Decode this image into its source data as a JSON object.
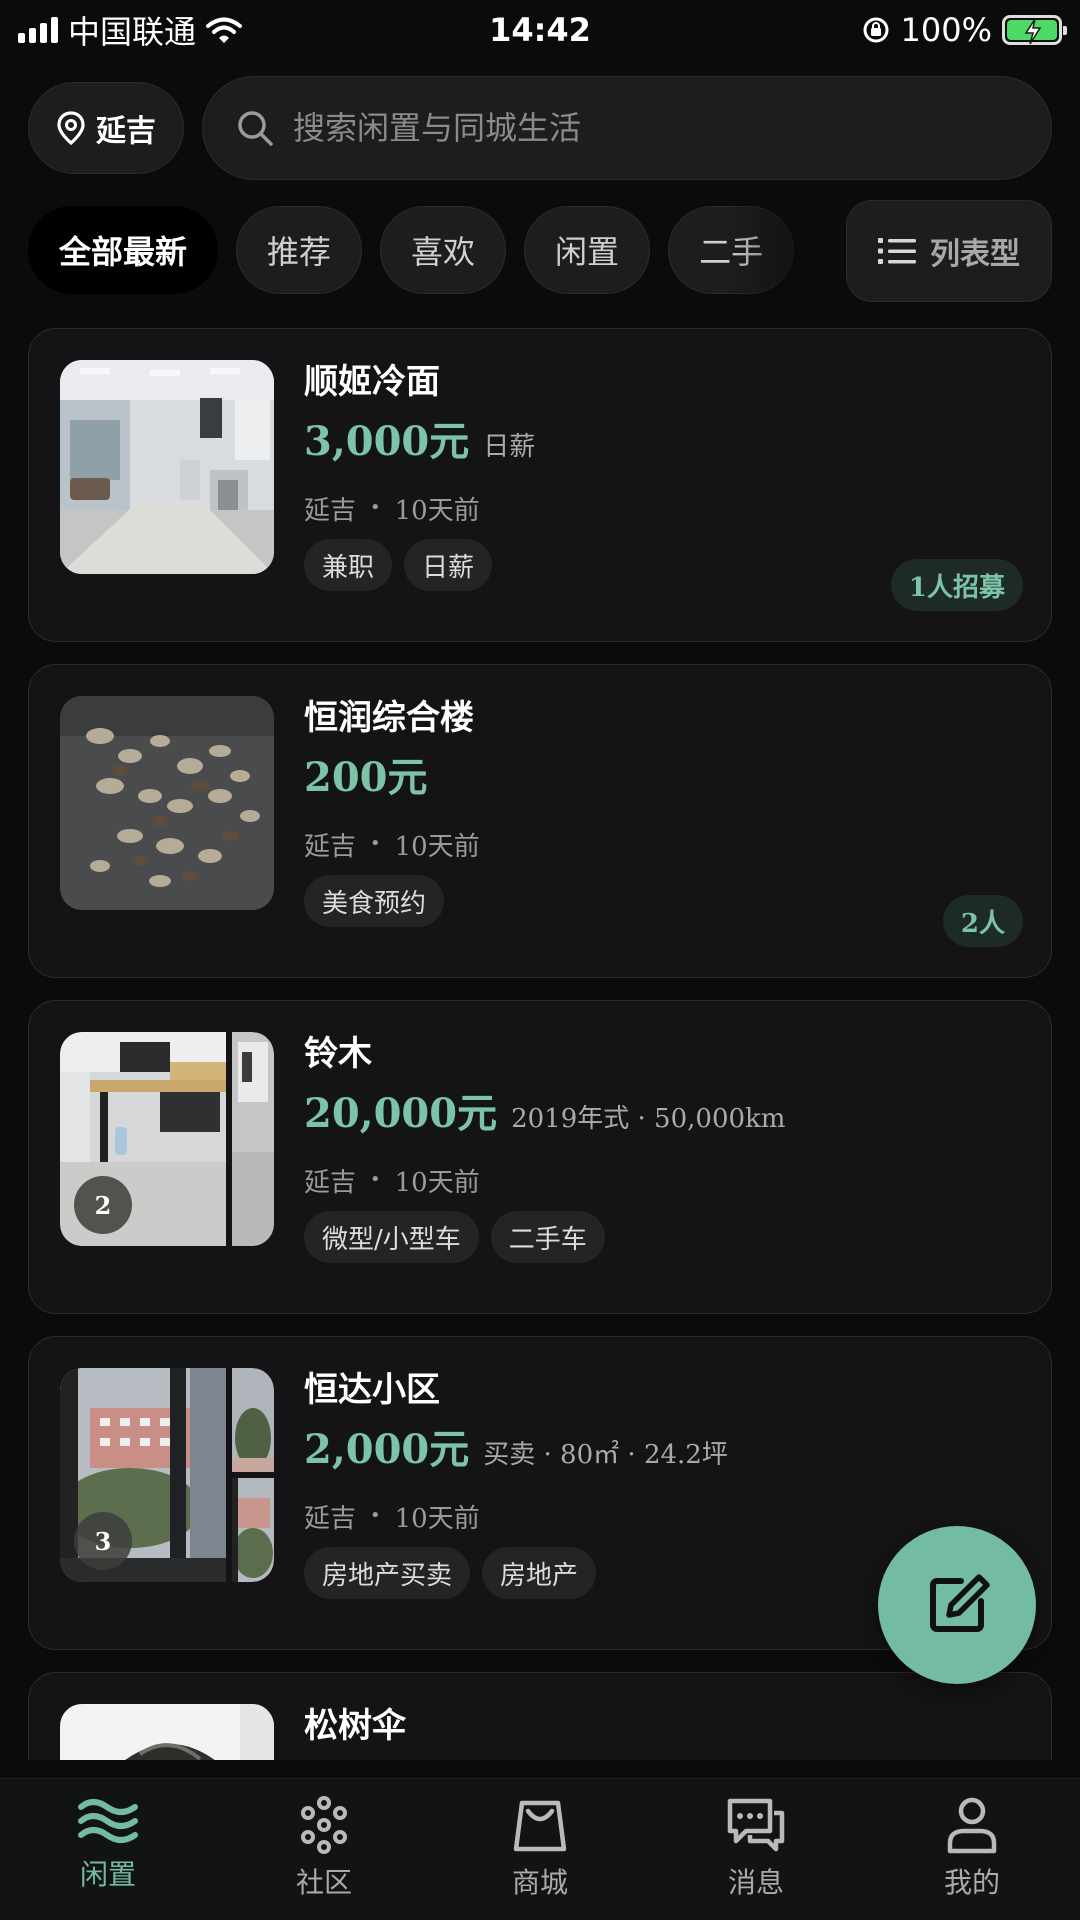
{
  "status_bar": {
    "carrier": "中国联通",
    "time": "14:42",
    "battery": "100%"
  },
  "location": {
    "label": "延吉"
  },
  "search": {
    "placeholder": "搜索闲置与同城生活"
  },
  "filters": [
    {
      "label": "全部最新",
      "active": true
    },
    {
      "label": "推荐"
    },
    {
      "label": "喜欢"
    },
    {
      "label": "闲置"
    },
    {
      "label": "二手"
    }
  ],
  "view_toggle": {
    "label": "列表型"
  },
  "listings": [
    {
      "title": "顺姬冷面",
      "price": "3,000元",
      "price_sub": "日薪",
      "location": "延吉",
      "time": "10天前",
      "tags": [
        "兼职",
        "日薪"
      ],
      "badge": "1人招募"
    },
    {
      "title": "恒润综合楼",
      "price": "200元",
      "price_sub": "",
      "location": "延吉",
      "time": "10天前",
      "tags": [
        "美食预约"
      ],
      "badge": "2人"
    },
    {
      "title": "铃木",
      "price": "20,000元",
      "price_sub": "2019年式 · 50,000km",
      "location": "延吉",
      "time": "10天前",
      "tags": [
        "微型/小型车",
        "二手车"
      ],
      "image_count": "2"
    },
    {
      "title": "恒达小区",
      "price": "2,000元",
      "price_sub": "买卖 · 80㎡ · 24.2坪",
      "location": "延吉",
      "time": "10天前",
      "tags": [
        "房地产买卖",
        "房地产"
      ],
      "image_count": "3"
    },
    {
      "title": "松树伞"
    }
  ],
  "nav": [
    {
      "label": "闲置",
      "icon": "waves-icon",
      "active": true
    },
    {
      "label": "社区",
      "icon": "community-dots-icon"
    },
    {
      "label": "商城",
      "icon": "shopping-bag-icon"
    },
    {
      "label": "消息",
      "icon": "chat-bubbles-icon"
    },
    {
      "label": "我的",
      "icon": "person-icon"
    }
  ],
  "colors": {
    "accent": "#74bba3",
    "price": "#7cc4a7",
    "background": "#0b0b0c",
    "card": "#141416"
  }
}
